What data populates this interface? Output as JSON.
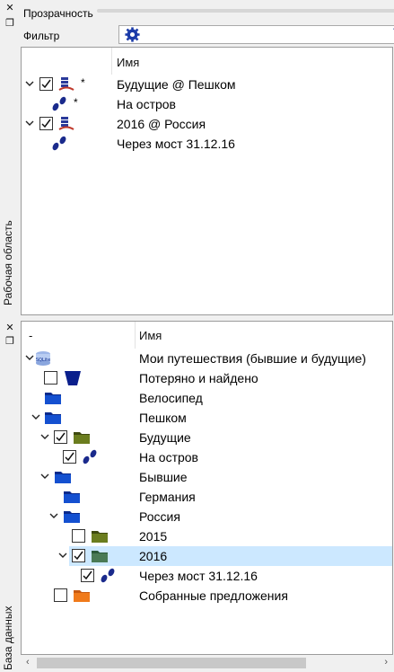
{
  "workspace": {
    "dock_label": "Рабочая область",
    "transparency_label": "Прозрачность",
    "filter_label": "Фильтр",
    "column_name": "Имя",
    "rows": [
      {
        "label": "Будущие @ Пешком",
        "checked": true,
        "expanded": true,
        "icon": "db-route-icon",
        "mark": "*"
      },
      {
        "label": "На остров",
        "checked": false,
        "expanded": false,
        "icon": "footprints-icon",
        "mark": "*"
      },
      {
        "label": "2016 @ Россия",
        "checked": true,
        "expanded": true,
        "icon": "db-route-icon",
        "mark": ""
      },
      {
        "label": "Через мост 31.12.16",
        "checked": false,
        "expanded": false,
        "icon": "footprints-icon",
        "mark": ""
      }
    ]
  },
  "database": {
    "dock_label": "База данных",
    "column_minus": "-",
    "column_name": "Имя",
    "rows": [
      {
        "label": "Мои путешествия (бывшие и будущие)",
        "icon": "sqlite-db-icon"
      },
      {
        "label": "Потеряно и найдено",
        "icon": "bin-icon"
      },
      {
        "label": "Велосипед",
        "icon": "folder-blue-icon"
      },
      {
        "label": "Пешком",
        "icon": "folder-blue-icon"
      },
      {
        "label": "Будущие",
        "icon": "folder-green-icon"
      },
      {
        "label": "На остров",
        "icon": "footprints-icon"
      },
      {
        "label": "Бывшие",
        "icon": "folder-blue-icon"
      },
      {
        "label": "Германия",
        "icon": "folder-blue-icon"
      },
      {
        "label": "Россия",
        "icon": "folder-blue-icon"
      },
      {
        "label": "2015",
        "icon": "folder-green-icon"
      },
      {
        "label": "2016",
        "icon": "folder-green-icon"
      },
      {
        "label": "Через мост 31.12.16",
        "icon": "footprints-icon"
      },
      {
        "label": "Собранные предложения",
        "icon": "folder-orange-icon"
      }
    ]
  },
  "colors": {
    "accent": "#1a7ee0",
    "selection": "#cce8ff",
    "folder_blue": "#0a2a8c",
    "folder_green": "#5a6b1a",
    "folder_orange": "#f07a1a"
  }
}
